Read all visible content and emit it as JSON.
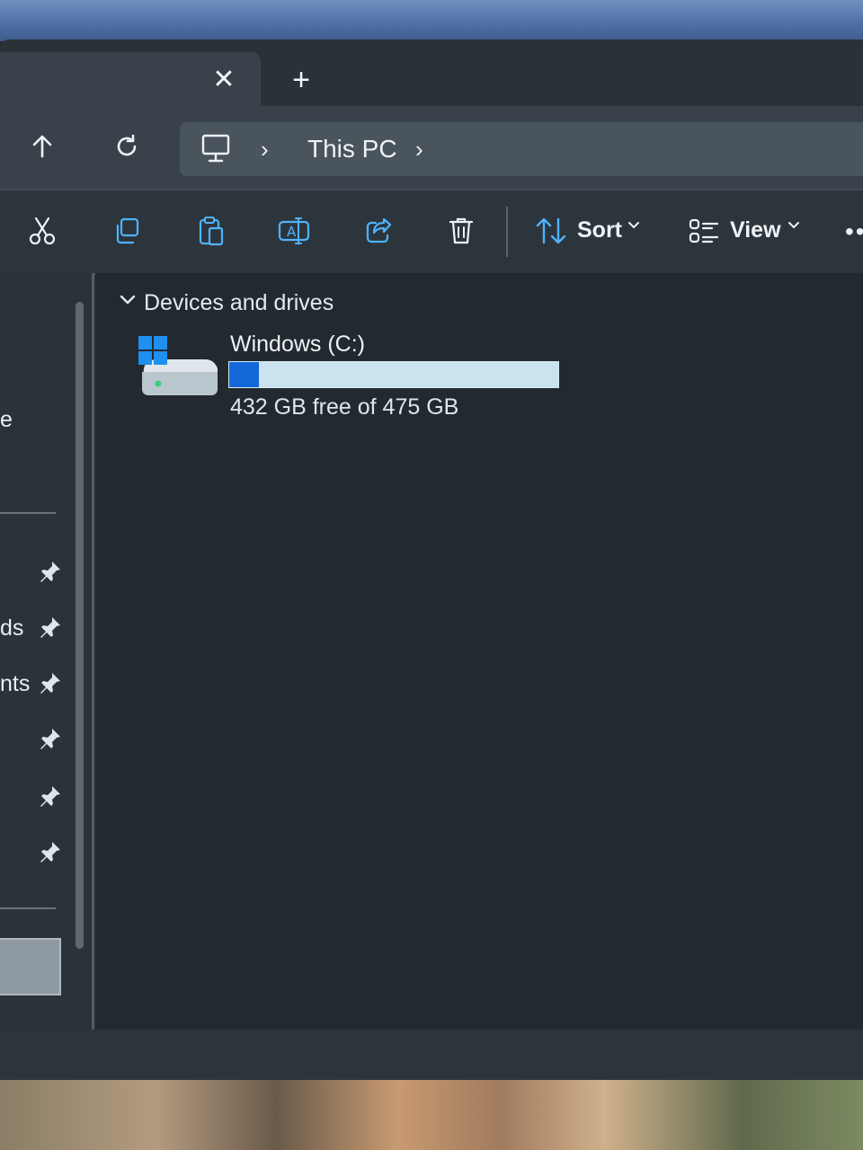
{
  "tabs": {
    "close_icon": "close-icon",
    "new_tab_icon": "plus-icon"
  },
  "navbar": {
    "up_icon": "arrow-up-icon",
    "refresh_icon": "refresh-icon",
    "address": {
      "location_icon": "monitor-icon",
      "breadcrumb": "This PC"
    }
  },
  "commandbar": {
    "icons": [
      "cut-icon",
      "copy-icon",
      "paste-icon",
      "rename-icon",
      "share-icon",
      "delete-icon"
    ],
    "sort_label": "Sort",
    "view_label": "View",
    "more_label": "••"
  },
  "sidebar": {
    "partial_labels": [
      "e",
      "ds",
      "nts"
    ],
    "pin_icon": "pin-icon"
  },
  "main": {
    "group_title": "Devices and drives",
    "drives": [
      {
        "name": "Windows (C:)",
        "free_text": "432 GB free of 475 GB",
        "used_fraction": 0.09
      }
    ]
  },
  "colors": {
    "accent": "#1468d8",
    "bar_track": "#c9e3ef",
    "background": "#222a30",
    "chrome": "#39424a"
  }
}
